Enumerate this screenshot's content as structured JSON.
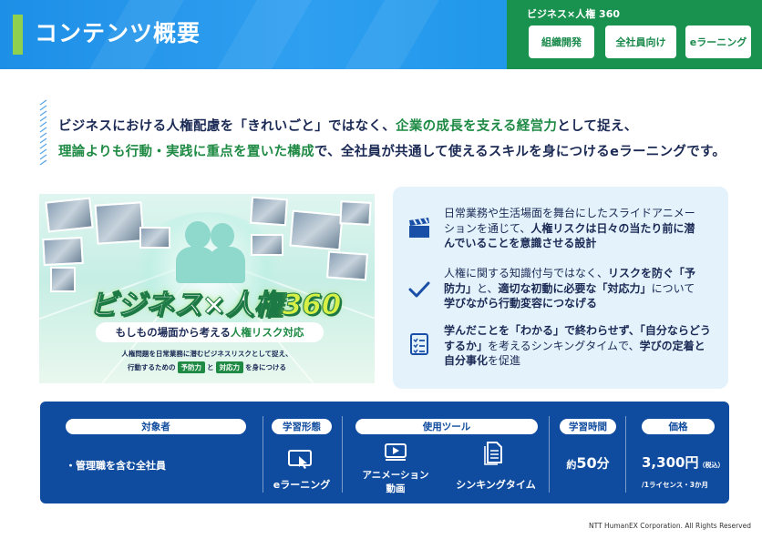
{
  "header": {
    "title": "コンテンツ概要",
    "tag_group_title": "ビジネス×人権 360",
    "tags": [
      "組織開発",
      "全社員向け",
      "eラーニング"
    ]
  },
  "intro": {
    "line1": [
      {
        "text": "ビジネスにおける",
        "style": "dk"
      },
      {
        "text": "人権配慮を「きれいごと」ではなく",
        "style": "dk"
      },
      {
        "text": "、",
        "style": "dk"
      },
      {
        "text": "企業の成長を支える経営力",
        "style": "hl"
      },
      {
        "text": "として捉え、",
        "style": "dk"
      }
    ],
    "line2": [
      {
        "text": "理論よりも行動・実践に重点を置いた構成",
        "style": "hl"
      },
      {
        "text": "で、全社員が共通して使えるスキルを身につけるeラーニングです。",
        "style": "dk"
      }
    ]
  },
  "banner": {
    "title_main": "ビジネス×人権",
    "title_num": "360",
    "subtitle_pre": "もしもの場面から考える",
    "subtitle_hl": "人権リスク対応",
    "line1": "人権問題を日常業務に潜むビジネスリスクとして捉え、",
    "line2_pre": "行動するための",
    "chip1": "予防力",
    "line2_mid": "と",
    "chip2": "対応力",
    "line2_post": "を身につける"
  },
  "features": [
    {
      "icon": "clapperboard-icon",
      "lines": [
        [
          {
            "t": "日常業務や生活場面を舞台にしたスライドアニメー",
            "s": ""
          }
        ],
        [
          {
            "t": "ションを通じて、",
            "s": ""
          },
          {
            "t": "人権リスクは日々の当たり前に潜",
            "s": "b"
          }
        ],
        [
          {
            "t": "んでいることを意識させる設計",
            "s": "b"
          }
        ]
      ]
    },
    {
      "icon": "check-icon",
      "lines": [
        [
          {
            "t": "人権に関する知識付与ではなく、",
            "s": ""
          },
          {
            "t": "リスクを防ぐ「予",
            "s": "b"
          }
        ],
        [
          {
            "t": "防力」",
            "s": "b"
          },
          {
            "t": "と、",
            "s": ""
          },
          {
            "t": "適切な初動に必要な「対応力」",
            "s": "b"
          },
          {
            "t": "について",
            "s": ""
          }
        ],
        [
          {
            "t": "学びながら行動変容につなげる",
            "s": "b"
          }
        ]
      ]
    },
    {
      "icon": "checklist-icon",
      "lines": [
        [
          {
            "t": "学んだことを「わかる」で終わらせず、「自分ならどう",
            "s": "b"
          }
        ],
        [
          {
            "t": "するか」",
            "s": "b"
          },
          {
            "t": "を考えるシンキングタイムで、",
            "s": ""
          },
          {
            "t": "学びの定着と",
            "s": "b"
          }
        ],
        [
          {
            "t": "自分事化",
            "s": "b"
          },
          {
            "t": "を促進",
            "s": ""
          }
        ]
      ]
    }
  ],
  "info": {
    "target": {
      "label": "対象者",
      "value": "・管理職を含む全社員"
    },
    "format": {
      "label": "学習形態",
      "value": "eラーニング"
    },
    "tools": {
      "label": "使用ツール",
      "tool1_line1": "アニメーション",
      "tool1_line2": "動画",
      "tool2": "シンキングタイム"
    },
    "time": {
      "label": "学習時間",
      "prefix": "約",
      "value": "50",
      "unit": "分"
    },
    "price": {
      "label": "価格",
      "value": "3,300円",
      "tax": "（税込）",
      "note": "/1ライセンス・3か月"
    }
  },
  "footer": {
    "copyright": "NTT HumanEX Corporation. All Rights Reserved"
  },
  "colors": {
    "header_blue": "#1d8fe6",
    "tag_green": "#19924f",
    "accent_green": "#1e8a44",
    "panel_navy": "#0f4b9e",
    "lime": "#8fd14f"
  }
}
